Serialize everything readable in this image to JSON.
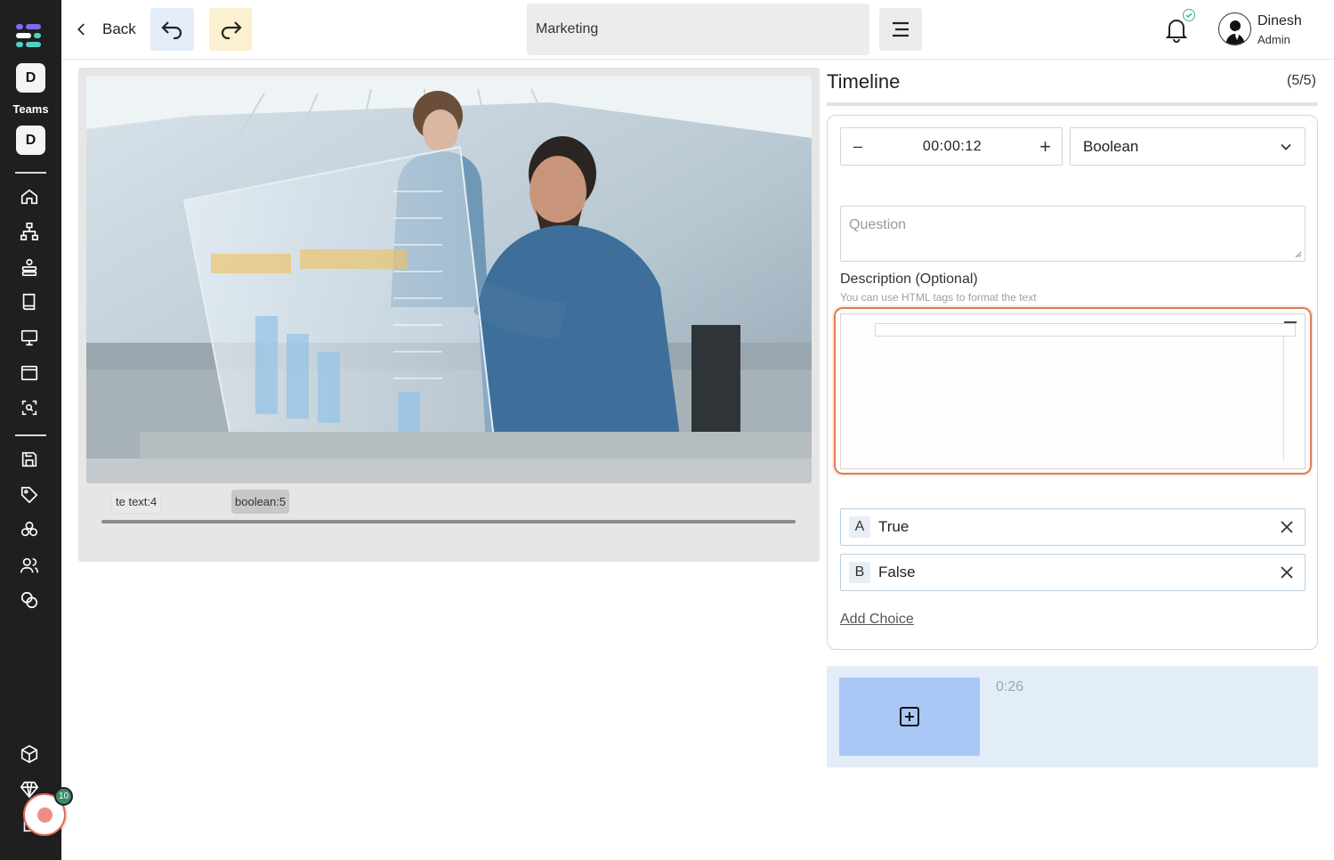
{
  "sidebar": {
    "team_chip_1": "D",
    "teams_label": "Teams",
    "team_chip_2": "D",
    "record_badge": "10"
  },
  "topbar": {
    "back_label": "Back",
    "title_value": "Marketing",
    "user": {
      "name": "Dinesh",
      "role": "Admin"
    }
  },
  "video": {
    "markers": [
      "te text:4",
      "boolean:5"
    ]
  },
  "timeline": {
    "title": "Timeline",
    "count": "(5/5)",
    "time_value": "00:00:12",
    "time_minus": "–",
    "time_plus": "+",
    "type_selected": "Boolean",
    "question_placeholder": "Question",
    "description_label": "Description (Optional)",
    "description_hint": "You can use HTML tags to format the text",
    "choices": [
      {
        "letter": "A",
        "text": "True"
      },
      {
        "letter": "B",
        "text": "False"
      }
    ],
    "add_choice_label": "Add Choice"
  },
  "clip": {
    "time": "0:26"
  },
  "colors": {
    "sidebar_bg": "#1f1f1f",
    "accent_orange": "#e07b52",
    "clip_panel": "#e3edf9",
    "clip_button": "#a9c8f5",
    "undo_bg": "#e3ecf9",
    "redo_bg": "#fbf0cf",
    "notification_check": "#2fb98f",
    "record_badge": "#3b8a6b"
  }
}
